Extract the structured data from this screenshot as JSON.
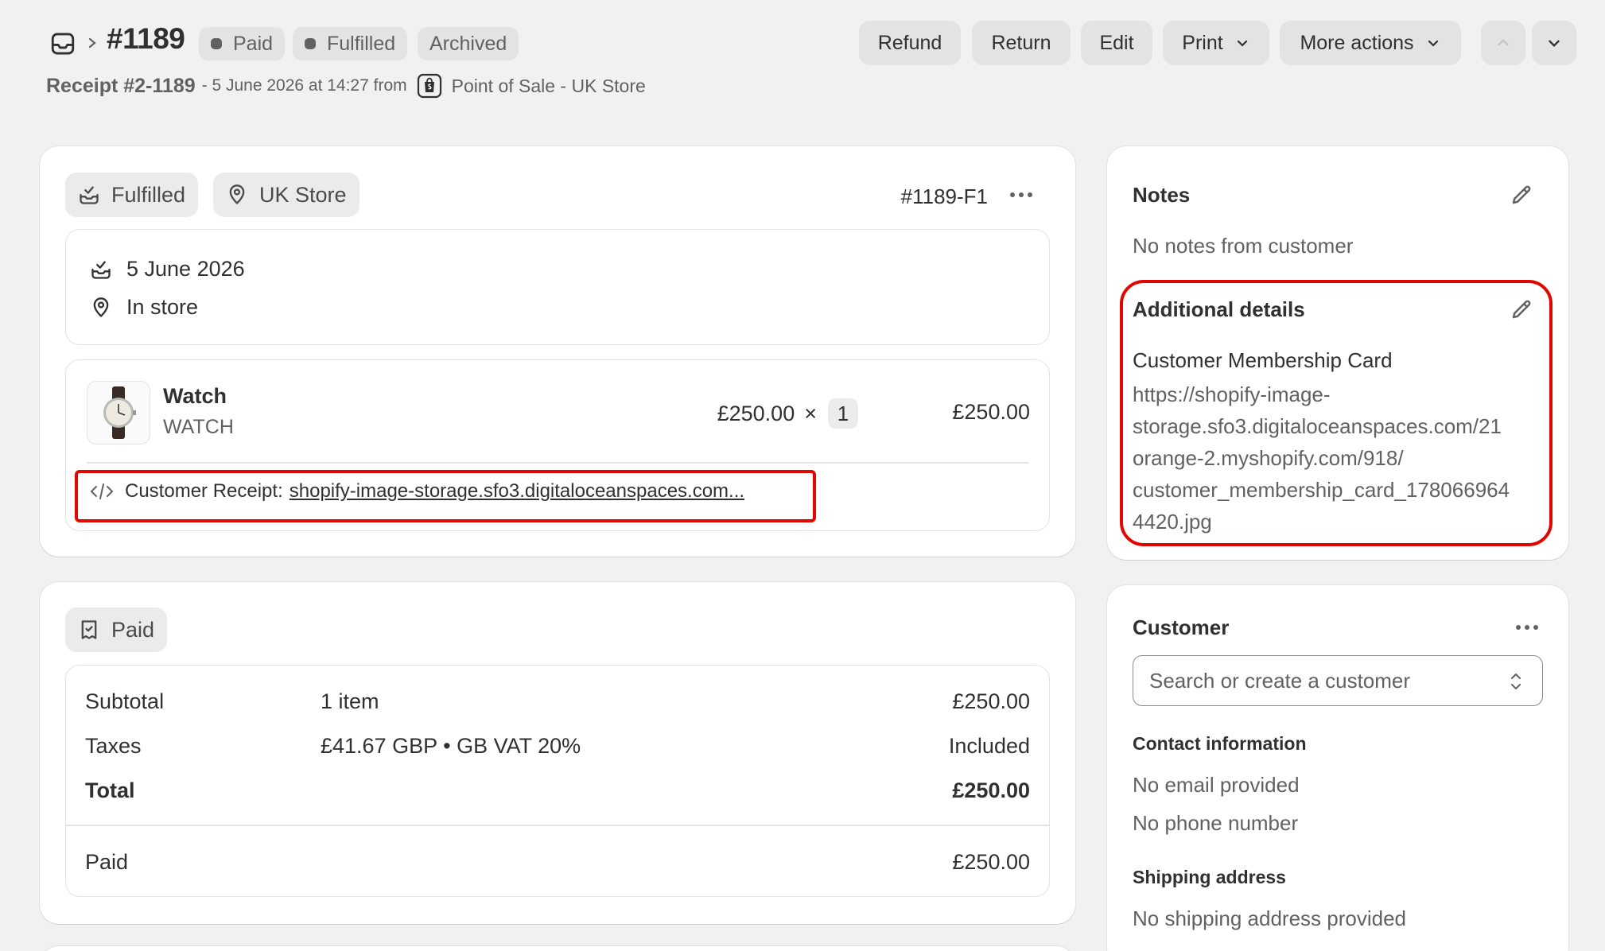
{
  "header": {
    "order_number": "#1189",
    "badges": [
      "Paid",
      "Fulfilled",
      "Archived"
    ],
    "actions": [
      "Refund",
      "Return",
      "Edit",
      "Print",
      "More actions"
    ],
    "receipt": "Receipt #2-1189",
    "meta": "- 5 June 2026 at 14:27 from",
    "source": "Point of Sale - UK Store"
  },
  "fulfillment": {
    "status": "Fulfilled",
    "location": "UK Store",
    "id": "#1189-F1",
    "date": "5 June 2026",
    "delivery": "In store",
    "item": {
      "name": "Watch",
      "sku": "WATCH",
      "price": "£250.00",
      "times": "×",
      "quantity": "1",
      "total": "£250.00"
    },
    "receipt_label": "Customer Receipt:",
    "receipt_link": "shopify-image-storage.sfo3.digitaloceanspaces.com..."
  },
  "payment": {
    "status": "Paid",
    "rows": [
      {
        "label": "Subtotal",
        "detail": "1 item",
        "value": "£250.00"
      },
      {
        "label": "Taxes",
        "detail": "£41.67 GBP • GB VAT 20%",
        "value": "Included"
      },
      {
        "label": "Total",
        "detail": "",
        "value": "£250.00"
      }
    ],
    "paid_label": "Paid",
    "paid_value": "£250.00"
  },
  "notes": {
    "title": "Notes",
    "text": "No notes from customer"
  },
  "additional": {
    "title": "Additional details",
    "field_label": "Customer Membership Card",
    "url_lines": [
      "https://shopify-image-",
      "storage.sfo3.digitaloceanspaces.com/21",
      "orange-2.myshopify.com/918/",
      "customer_membership_card_178066964",
      "4420.jpg"
    ]
  },
  "customer": {
    "title": "Customer",
    "search_placeholder": "Search or create a customer",
    "contact_title": "Contact information",
    "email": "No email provided",
    "phone": "No phone number",
    "shipping_title": "Shipping address",
    "shipping": "No shipping address provided"
  },
  "colors": {
    "highlight": "#e10600",
    "badge_bg": "#e3e3e3",
    "page_bg": "#f1f1f1"
  },
  "icons": [
    "inbox-icon",
    "chevron-right-icon",
    "chevron-down-icon",
    "chevron-up-icon",
    "pos-bag-icon",
    "fulfilled-icon",
    "location-pin-icon",
    "code-icon",
    "receipt-check-icon",
    "pencil-icon",
    "select-arrows-icon",
    "more-horizontal-icon"
  ]
}
